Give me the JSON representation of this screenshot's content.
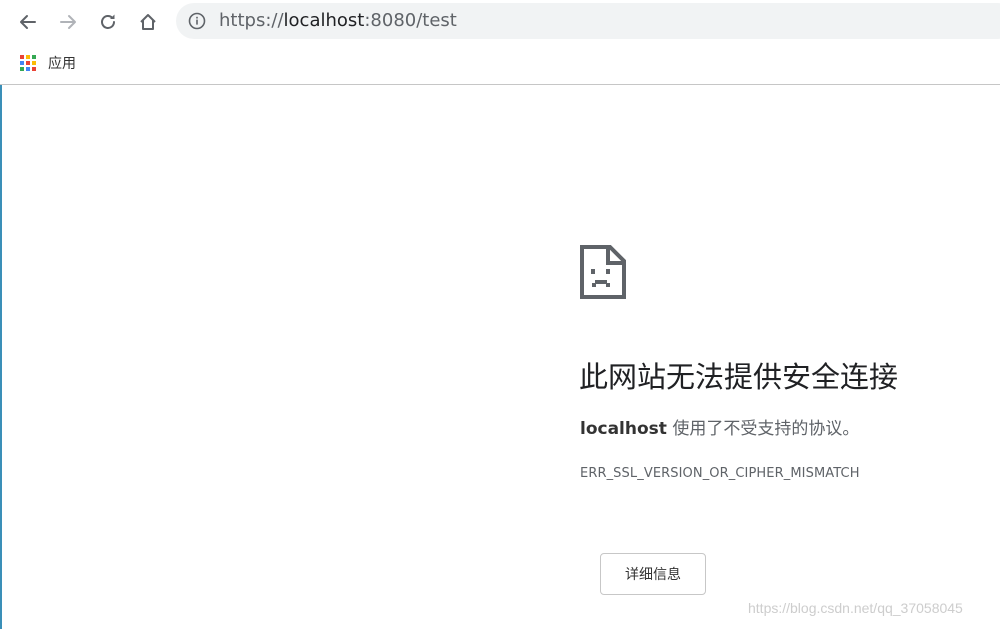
{
  "toolbar": {
    "back_icon": "back-arrow-icon",
    "forward_icon": "forward-arrow-icon",
    "reload_icon": "reload-icon",
    "home_icon": "home-icon"
  },
  "omnibox": {
    "scheme": "https://",
    "host": "localhost",
    "rest": ":8080/test",
    "icon": "info-icon"
  },
  "bookmarks": {
    "apps_label": "应用",
    "apps_colors": [
      "#ea4335",
      "#fbbc05",
      "#34a853",
      "#4285f4",
      "#ea4335",
      "#fbbc05",
      "#34a853",
      "#4285f4",
      "#ea4335"
    ]
  },
  "error": {
    "title": "此网站无法提供安全连接",
    "host": "localhost",
    "message": " 使用了不受支持的协议。",
    "code": "ERR_SSL_VERSION_OR_CIPHER_MISMATCH",
    "details_label": "详细信息",
    "icon": "sad-page-icon"
  },
  "watermark": "https://blog.csdn.net/qq_37058045"
}
